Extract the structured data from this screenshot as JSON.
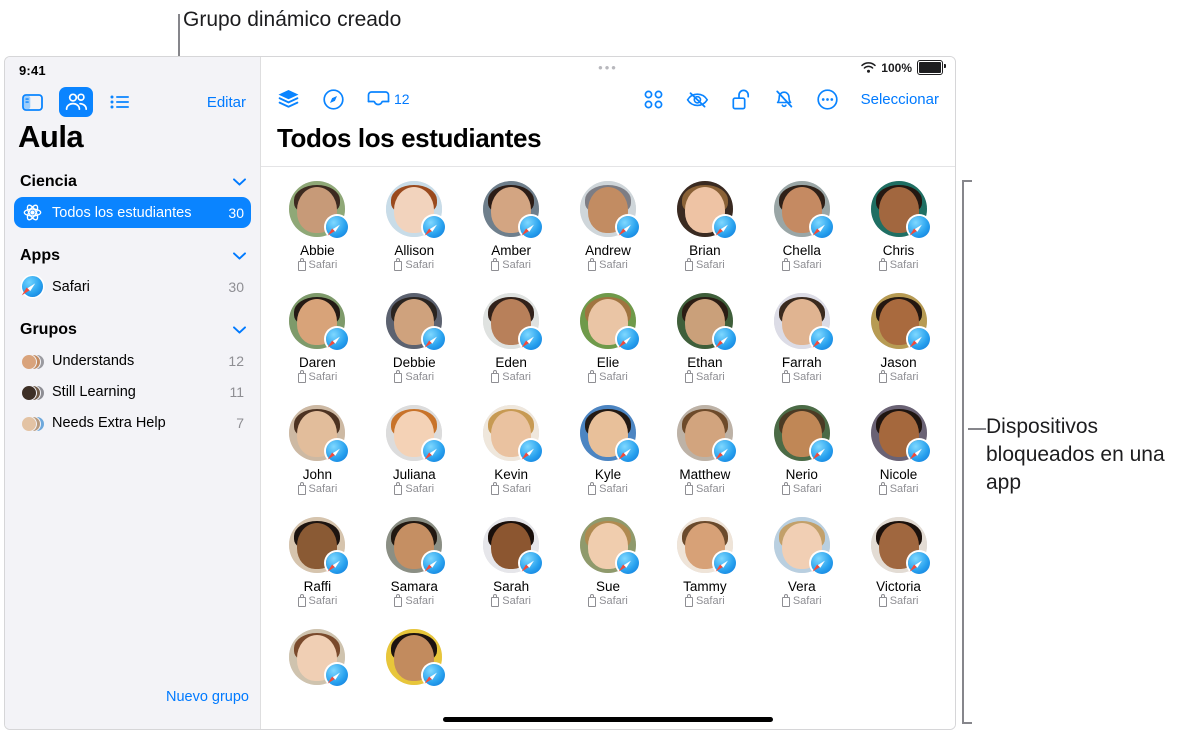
{
  "callouts": {
    "top": "Grupo dinámico creado",
    "right": "Dispositivos bloqueados en una app"
  },
  "device": {
    "status_bar": {
      "time": "9:41",
      "battery_percent": "100%",
      "wifi_icon": "wifi-icon",
      "battery_icon": "battery-icon",
      "grabber": "•••"
    }
  },
  "sidebar": {
    "segmented": [
      {
        "icon": "sidebar-toggle-icon",
        "active": false
      },
      {
        "icon": "people-icon",
        "active": true
      },
      {
        "icon": "list-icon",
        "active": false
      }
    ],
    "edit_label": "Editar",
    "title": "Aula",
    "sections": [
      {
        "id": "ciencia",
        "header": "Ciencia",
        "chevron": "chevron-down-icon",
        "rows": [
          {
            "icon": "atom-icon",
            "label": "Todos los estudiantes",
            "count": "30",
            "selected": true
          }
        ]
      },
      {
        "id": "apps",
        "header": "Apps",
        "chevron": "chevron-down-icon",
        "rows": [
          {
            "icon": "safari-icon",
            "label": "Safari",
            "count": "30",
            "selected": false
          }
        ]
      },
      {
        "id": "grupos",
        "header": "Grupos",
        "chevron": "chevron-down-icon",
        "rows": [
          {
            "icon": "group-avatars-icon",
            "label": "Understands",
            "count": "12",
            "selected": false
          },
          {
            "icon": "group-avatars-icon",
            "label": "Still Learning",
            "count": "11",
            "selected": false
          },
          {
            "icon": "group-avatars-icon",
            "label": "Needs Extra Help",
            "count": "7",
            "selected": false
          }
        ]
      }
    ],
    "new_group_label": "Nuevo grupo"
  },
  "toolbar": {
    "left": [
      {
        "icon": "layers-icon",
        "badge": ""
      },
      {
        "icon": "navigate-compass-icon",
        "badge": ""
      },
      {
        "icon": "inbox-tray-icon",
        "badge": "12"
      }
    ],
    "right": [
      {
        "icon": "grid-view-icon"
      },
      {
        "icon": "eye-slash-icon"
      },
      {
        "icon": "unlock-icon"
      },
      {
        "icon": "bell-slash-icon"
      },
      {
        "icon": "ellipsis-circle-icon"
      }
    ],
    "select_label": "Seleccionar"
  },
  "main": {
    "page_title": "Todos los estudiantes",
    "students": [
      {
        "name": "Abbie",
        "app": "Safari",
        "skin": "#c79a78",
        "hair": "#3c2a20",
        "bg": "#8fa877",
        "badge": "safari-icon"
      },
      {
        "name": "Allison",
        "app": "Safari",
        "skin": "#f2d3bd",
        "hair": "#9a4a1e",
        "bg": "#c8dce8",
        "badge": "safari-icon"
      },
      {
        "name": "Amber",
        "app": "Safari",
        "skin": "#d3a582",
        "hair": "#2b1c16",
        "bg": "#6f7f8c",
        "badge": "safari-icon"
      },
      {
        "name": "Andrew",
        "app": "Safari",
        "skin": "#c28c62",
        "hair": "#7d7d84",
        "bg": "#cfd6da",
        "badge": "safari-icon"
      },
      {
        "name": "Brian",
        "app": "Safari",
        "skin": "#eec3a4",
        "hair": "#8a6136",
        "bg": "#3a2a21",
        "badge": "safari-icon"
      },
      {
        "name": "Chella",
        "app": "Safari",
        "skin": "#c58a62",
        "hair": "#2e2018",
        "bg": "#9aa6a6",
        "badge": "safari-icon"
      },
      {
        "name": "Chris",
        "app": "Safari",
        "skin": "#a2673f",
        "hair": "#241812",
        "bg": "#1f6f63",
        "badge": "safari-icon"
      },
      {
        "name": "Daren",
        "app": "Safari",
        "skin": "#d8a379",
        "hair": "#241a14",
        "bg": "#7e9a6a",
        "badge": "safari-icon"
      },
      {
        "name": "Debbie",
        "app": "Safari",
        "skin": "#cfa27d",
        "hair": "#2a2420",
        "bg": "#5c6270",
        "badge": "safari-icon"
      },
      {
        "name": "Eden",
        "app": "Safari",
        "skin": "#b8805a",
        "hair": "#31211a",
        "bg": "#dfe2e0",
        "badge": "safari-icon"
      },
      {
        "name": "Elie",
        "app": "Safari",
        "skin": "#eac5a5",
        "hair": "#a07440",
        "bg": "#6f9a4a",
        "badge": "safari-icon"
      },
      {
        "name": "Ethan",
        "app": "Safari",
        "skin": "#caa07a",
        "hair": "#2b1d14",
        "bg": "#3f5f3a",
        "badge": "safari-icon"
      },
      {
        "name": "Farrah",
        "app": "Safari",
        "skin": "#e0b491",
        "hair": "#3a2a1e",
        "bg": "#dcdce6",
        "badge": "safari-icon"
      },
      {
        "name": "Jason",
        "app": "Safari",
        "skin": "#a96a3e",
        "hair": "#231710",
        "bg": "#b79b53",
        "badge": "safari-icon"
      },
      {
        "name": "John",
        "app": "Safari",
        "skin": "#e2bd9b",
        "hair": "#4d3322",
        "bg": "#cdb9a3",
        "badge": "safari-icon"
      },
      {
        "name": "Juliana",
        "app": "Safari",
        "skin": "#f4d2b6",
        "hair": "#c8732a",
        "bg": "#dcdcdc",
        "badge": "safari-icon"
      },
      {
        "name": "Kevin",
        "app": "Safari",
        "skin": "#eac2a0",
        "hair": "#c79a53",
        "bg": "#efe7dc",
        "badge": "safari-icon"
      },
      {
        "name": "Kyle",
        "app": "Safari",
        "skin": "#e8c09a",
        "hair": "#231a14",
        "bg": "#4c85c2",
        "badge": "safari-icon"
      },
      {
        "name": "Matthew",
        "app": "Safari",
        "skin": "#d2a47e",
        "hair": "#6d4a2a",
        "bg": "#bdb2a6",
        "badge": "safari-icon"
      },
      {
        "name": "Nerio",
        "app": "Safari",
        "skin": "#c08756",
        "hair": "#4a3a24",
        "bg": "#4b6b46",
        "badge": "safari-icon"
      },
      {
        "name": "Nicole",
        "app": "Safari",
        "skin": "#a5683d",
        "hair": "#1f1510",
        "bg": "#6a6274",
        "badge": "safari-icon"
      },
      {
        "name": "Raffi",
        "app": "Safari",
        "skin": "#8a5a34",
        "hair": "#1d1410",
        "bg": "#d6c4ad",
        "badge": "safari-icon"
      },
      {
        "name": "Samara",
        "app": "Safari",
        "skin": "#c58f63",
        "hair": "#211811",
        "bg": "#8b8f84",
        "badge": "safari-icon"
      },
      {
        "name": "Sarah",
        "app": "Safari",
        "skin": "#8c5630",
        "hair": "#190f0b",
        "bg": "#e6e6ea",
        "badge": "safari-icon"
      },
      {
        "name": "Sue",
        "app": "Safari",
        "skin": "#f0cdae",
        "hair": "#b08a50",
        "bg": "#8f9a6c",
        "badge": "safari-icon"
      },
      {
        "name": "Tammy",
        "app": "Safari",
        "skin": "#d7a177",
        "hair": "#6b4a2c",
        "bg": "#efe4d8",
        "badge": "safari-icon"
      },
      {
        "name": "Vera",
        "app": "Safari",
        "skin": "#f1cfb4",
        "hair": "#c2a06a",
        "bg": "#b9cfe0",
        "badge": "safari-icon"
      },
      {
        "name": "Victoria",
        "app": "Safari",
        "skin": "#a0673f",
        "hair": "#1b110c",
        "bg": "#e3dcd4",
        "badge": "safari-icon"
      },
      {
        "name": "",
        "app": "",
        "skin": "#f0cfb4",
        "hair": "#7a4a2c",
        "bg": "#cfc3ae",
        "badge": "safari-icon"
      },
      {
        "name": "",
        "app": "",
        "skin": "#c28b5e",
        "hair": "#1d1310",
        "bg": "#e8c63a",
        "badge": "safari-icon"
      }
    ]
  }
}
